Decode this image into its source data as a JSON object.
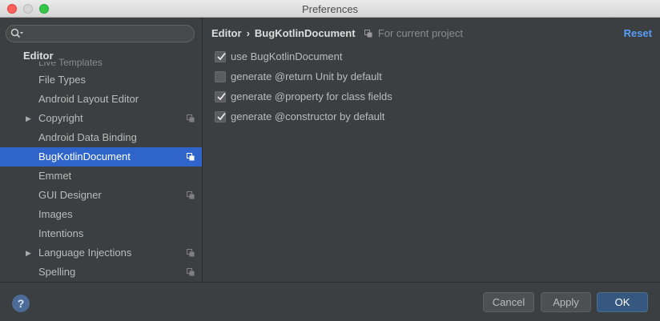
{
  "window": {
    "title": "Preferences"
  },
  "sidebar": {
    "search_placeholder": "",
    "section_header": "Editor",
    "ghost_item": "Live Templates",
    "items": [
      {
        "label": "File Types",
        "expandable": false,
        "project_icon": false,
        "selected": false
      },
      {
        "label": "Android Layout Editor",
        "expandable": false,
        "project_icon": false,
        "selected": false
      },
      {
        "label": "Copyright",
        "expandable": true,
        "project_icon": true,
        "selected": false
      },
      {
        "label": "Android Data Binding",
        "expandable": false,
        "project_icon": false,
        "selected": false
      },
      {
        "label": "BugKotlinDocument",
        "expandable": false,
        "project_icon": true,
        "selected": true
      },
      {
        "label": "Emmet",
        "expandable": false,
        "project_icon": false,
        "selected": false
      },
      {
        "label": "GUI Designer",
        "expandable": false,
        "project_icon": true,
        "selected": false
      },
      {
        "label": "Images",
        "expandable": false,
        "project_icon": false,
        "selected": false
      },
      {
        "label": "Intentions",
        "expandable": false,
        "project_icon": false,
        "selected": false
      },
      {
        "label": "Language Injections",
        "expandable": true,
        "project_icon": true,
        "selected": false
      },
      {
        "label": "Spelling",
        "expandable": false,
        "project_icon": true,
        "selected": false
      }
    ]
  },
  "main": {
    "breadcrumb": {
      "root": "Editor",
      "separator": "›",
      "page": "BugKotlinDocument",
      "scope": "For current project"
    },
    "reset_label": "Reset",
    "options": [
      {
        "label": "use BugKotlinDocument",
        "checked": true
      },
      {
        "label": "generate @return Unit by default",
        "checked": false
      },
      {
        "label": "generate @property for class fields",
        "checked": true
      },
      {
        "label": "generate @constructor by default",
        "checked": true
      }
    ]
  },
  "footer": {
    "help_label": "?",
    "cancel_label": "Cancel",
    "apply_label": "Apply",
    "ok_label": "OK"
  },
  "colors": {
    "background": "#3c3f41",
    "selection": "#2f65ca",
    "link": "#589df6",
    "ok_button": "#365880"
  }
}
